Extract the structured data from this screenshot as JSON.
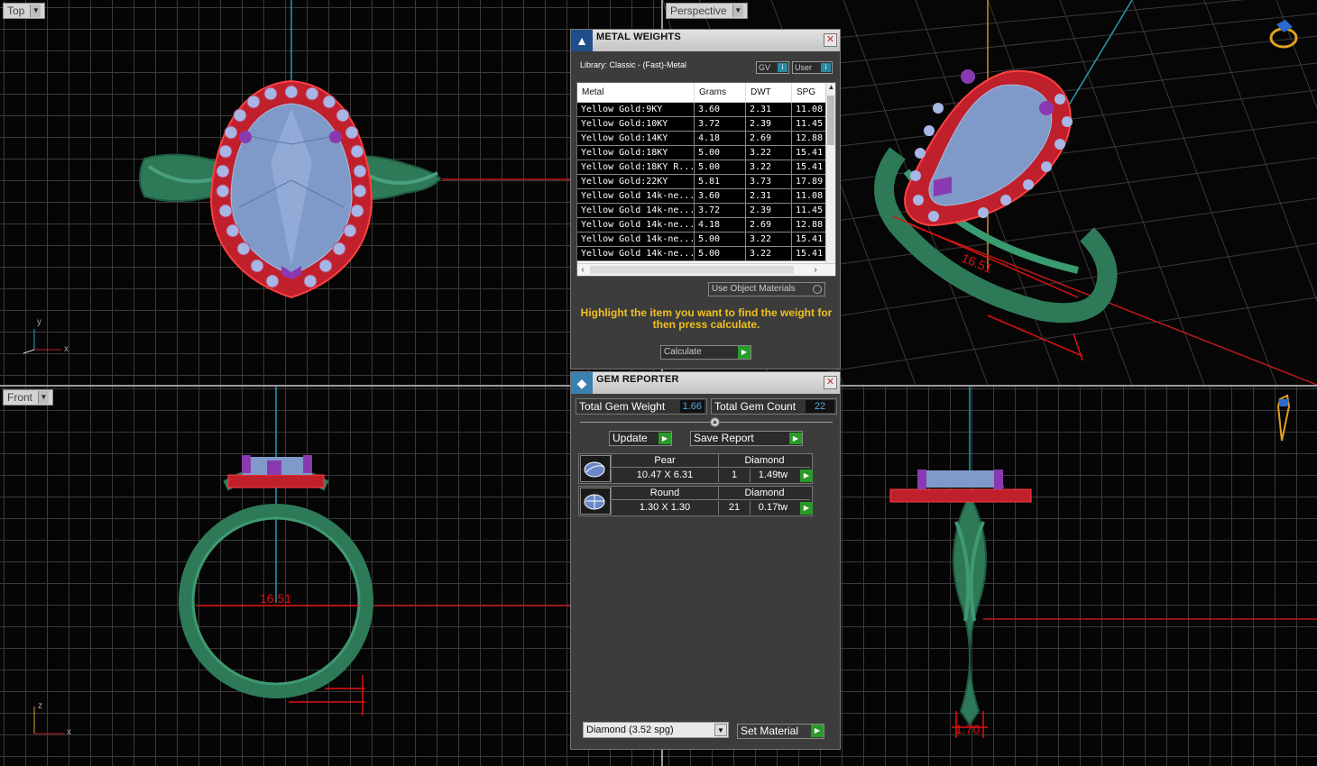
{
  "viewports": {
    "top": {
      "label": "Top",
      "axis_v": "y",
      "axis_h": "x"
    },
    "perspective": {
      "label": "Perspective",
      "dimension": "16.51"
    },
    "front": {
      "label": "Front",
      "axis_v": "z",
      "axis_h": "x",
      "dimension": "16.51"
    },
    "right": {
      "dimension": "1.70"
    }
  },
  "metal_weights": {
    "title": "METAL WEIGHTS",
    "library_label": "Library: Classic - (Fast)-Metal",
    "toggle_gv": "GV",
    "toggle_user": "User",
    "columns": [
      "Metal",
      "Grams",
      "DWT",
      "SPG"
    ],
    "rows": [
      [
        "Yellow Gold:9KY",
        "3.60",
        "2.31",
        "11.08"
      ],
      [
        "Yellow Gold:10KY",
        "3.72",
        "2.39",
        "11.45"
      ],
      [
        "Yellow Gold:14KY",
        "4.18",
        "2.69",
        "12.88"
      ],
      [
        "Yellow Gold:18KY",
        "5.00",
        "3.22",
        "15.41"
      ],
      [
        "Yellow Gold:18KY R...",
        "5.00",
        "3.22",
        "15.41"
      ],
      [
        "Yellow Gold:22KY",
        "5.81",
        "3.73",
        "17.89"
      ],
      [
        "Yellow Gold 14k-ne...",
        "3.60",
        "2.31",
        "11.08"
      ],
      [
        "Yellow Gold 14k-ne...",
        "3.72",
        "2.39",
        "11.45"
      ],
      [
        "Yellow Gold 14k-ne...",
        "4.18",
        "2.69",
        "12.88"
      ],
      [
        "Yellow Gold 14k-ne...",
        "5.00",
        "3.22",
        "15.41"
      ],
      [
        "Yellow Gold 14k-ne...",
        "5.00",
        "3.22",
        "15.41"
      ]
    ],
    "use_object_materials": "Use Object Materials",
    "hint": "Highlight the item you want to find the weight for then press calculate.",
    "calculate": "Calculate"
  },
  "gem_reporter": {
    "title": "GEM REPORTER",
    "total_weight_label": "Total Gem Weight",
    "total_weight": "1.66",
    "total_count_label": "Total Gem Count",
    "total_count": "22",
    "update": "Update",
    "save_report": "Save Report",
    "gems": [
      {
        "shape": "Pear",
        "material": "Diamond",
        "size": "10.47 X 6.31",
        "count": "1",
        "weight": "1.49tw"
      },
      {
        "shape": "Round",
        "material": "Diamond",
        "size": "1.30 X 1.30",
        "count": "21",
        "weight": "0.17tw"
      }
    ],
    "material_select": "Diamond    (3.52 spg)",
    "set_material": "Set Material"
  },
  "colors": {
    "ring_green": "#2f7d5c",
    "halo_red": "#c02030",
    "stone_blue": "#7f9ac8",
    "prong_purple": "#8a3ab0",
    "dimension_red": "#e01010",
    "accent_yellow": "#f0c020"
  }
}
